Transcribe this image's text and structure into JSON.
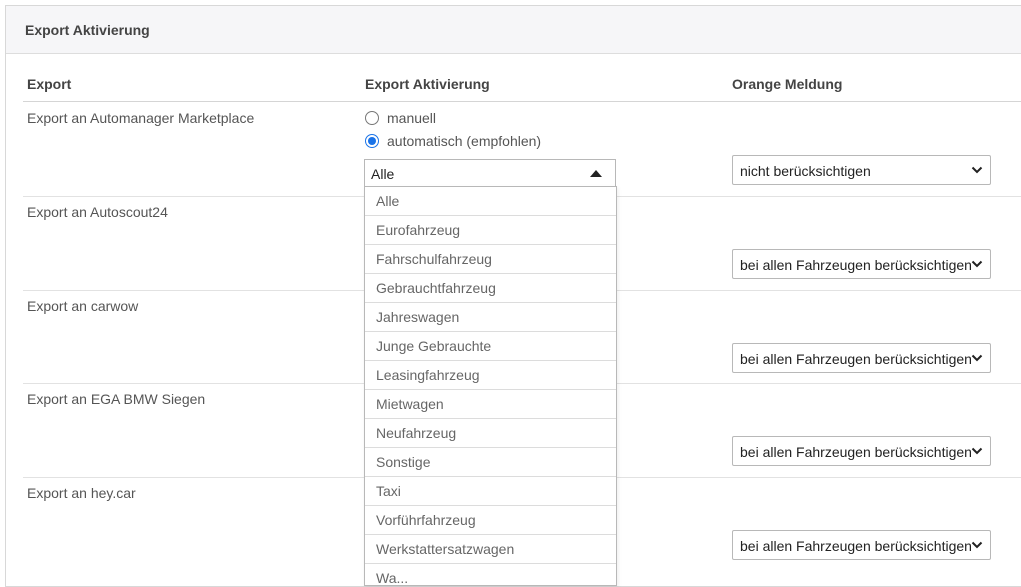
{
  "panel": {
    "title": "Export Aktivierung"
  },
  "table": {
    "headers": [
      "Export",
      "Export Aktivierung",
      "Orange Meldung"
    ]
  },
  "exports": [
    {
      "name": "Export an Automanager Marketplace",
      "orange_meldung": "nicht berücksichtigen"
    },
    {
      "name": "Export an Autoscout24",
      "orange_meldung": "bei allen Fahrzeugen berücksichtigen"
    },
    {
      "name": "Export an carwow",
      "orange_meldung": "bei allen Fahrzeugen berücksichtigen"
    },
    {
      "name": "Export an EGA BMW Siegen",
      "orange_meldung": "bei allen Fahrzeugen berücksichtigen"
    },
    {
      "name": "Export an hey.car",
      "orange_meldung": "bei allen Fahrzeugen berücksichtigen"
    }
  ],
  "aktivierung": {
    "radio_manual": "manuell",
    "radio_auto": "automatisch (empfohlen)",
    "selected_radio": "automatisch (empfohlen)",
    "vehicle_select_value": "Alle",
    "vehicle_options": [
      "Alle",
      "Eurofahrzeug",
      "Fahrschulfahrzeug",
      "Gebrauchtfahrzeug",
      "Jahreswagen",
      "Junge Gebrauchte",
      "Leasingfahrzeug",
      "Mietwagen",
      "Neufahrzeug",
      "Sonstige",
      "Taxi",
      "Vorführfahrzeug",
      "Werkstattersatzwagen",
      "Wa..."
    ]
  },
  "icons": {
    "caret": "caret-up-icon",
    "chevron": "chevron-down-icon"
  },
  "colors": {
    "radio_accent": "#1a73e8",
    "header_bg": "#f6f6f8"
  }
}
